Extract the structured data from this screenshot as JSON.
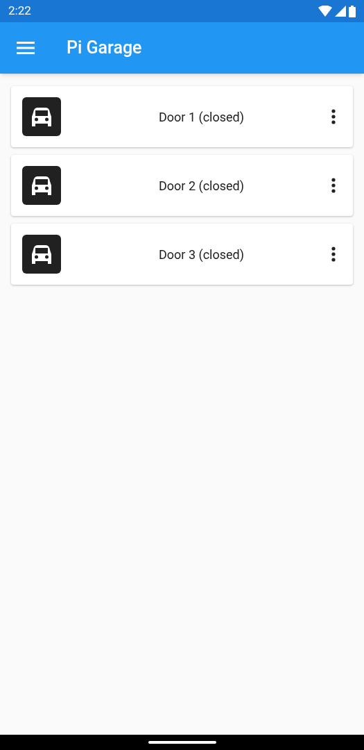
{
  "status_bar": {
    "time": "2:22"
  },
  "app_bar": {
    "title": "Pi Garage"
  },
  "doors": [
    {
      "label": "Door 1 (closed)"
    },
    {
      "label": "Door 2 (closed)"
    },
    {
      "label": "Door 3 (closed)"
    }
  ]
}
